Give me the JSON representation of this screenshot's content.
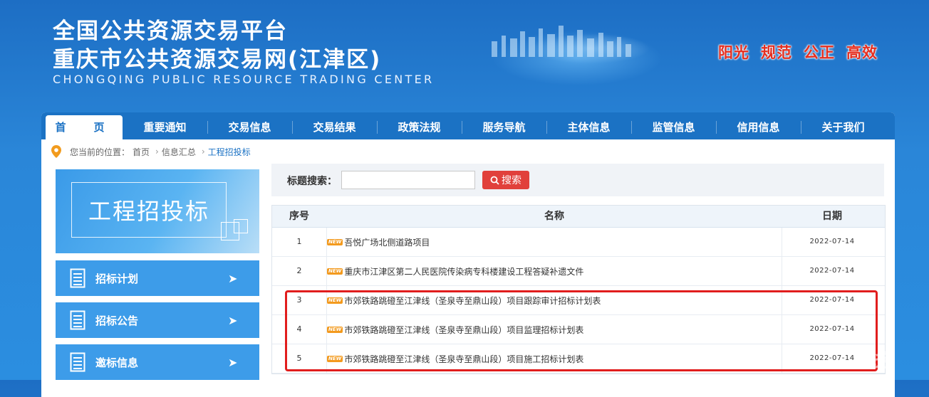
{
  "header": {
    "title_line1": "全国公共资源交易平台",
    "title_line2": "重庆市公共资源交易网(江津区)",
    "title_en": "CHONGQING PUBLIC RESOURCE TRADING CENTER",
    "slogans": [
      "阳光",
      "规范",
      "公正",
      "高效"
    ],
    "slogan_color": "#e52e1f"
  },
  "nav": {
    "items": [
      "首　页",
      "重要通知",
      "交易信息",
      "交易结果",
      "政策法规",
      "服务导航",
      "主体信息",
      "监管信息",
      "信用信息",
      "关于我们"
    ]
  },
  "breadcrumb": {
    "prefix": "您当前的位置：",
    "items": [
      "首页",
      "信息汇总",
      "工程招投标"
    ]
  },
  "sidebar": {
    "banner_title": "工程招投标",
    "items": [
      {
        "label": "招标计划",
        "icon": "document-icon"
      },
      {
        "label": "招标公告",
        "icon": "document-icon"
      },
      {
        "label": "邀标信息",
        "icon": "document-icon"
      }
    ],
    "arrow_glyph": "➤"
  },
  "search": {
    "label": "标题搜索：",
    "value": "",
    "placeholder": "",
    "button_label": "搜索"
  },
  "table": {
    "headers": [
      "序号",
      "名称",
      "日期"
    ],
    "new_badge": "NEW",
    "rows": [
      {
        "no": "1",
        "title": "吾悦广场北侧道路项目",
        "date": "2022-07-14"
      },
      {
        "no": "2",
        "title": "重庆市江津区第二人民医院传染病专科楼建设工程答疑补遗文件",
        "date": "2022-07-14"
      },
      {
        "no": "3",
        "title": "市郊铁路跳磴至江津线（圣泉寺至鼎山段）项目跟踪审计招标计划表",
        "date": "2022-07-14"
      },
      {
        "no": "4",
        "title": "市郊铁路跳磴至江津线（圣泉寺至鼎山段）项目监理招标计划表",
        "date": "2022-07-14"
      },
      {
        "no": "5",
        "title": "市郊铁路跳磴至江津线（圣泉寺至鼎山段）项目施工招标计划表",
        "date": "2022-07-14"
      }
    ]
  },
  "watermark": "线",
  "colors": {
    "nav_bg": "#1b72c4",
    "sidebar_item_bg": "#3d9ce9",
    "search_button": "#e1403b",
    "highlight": "#e11d1d",
    "new_badge": "#f39a1e"
  }
}
